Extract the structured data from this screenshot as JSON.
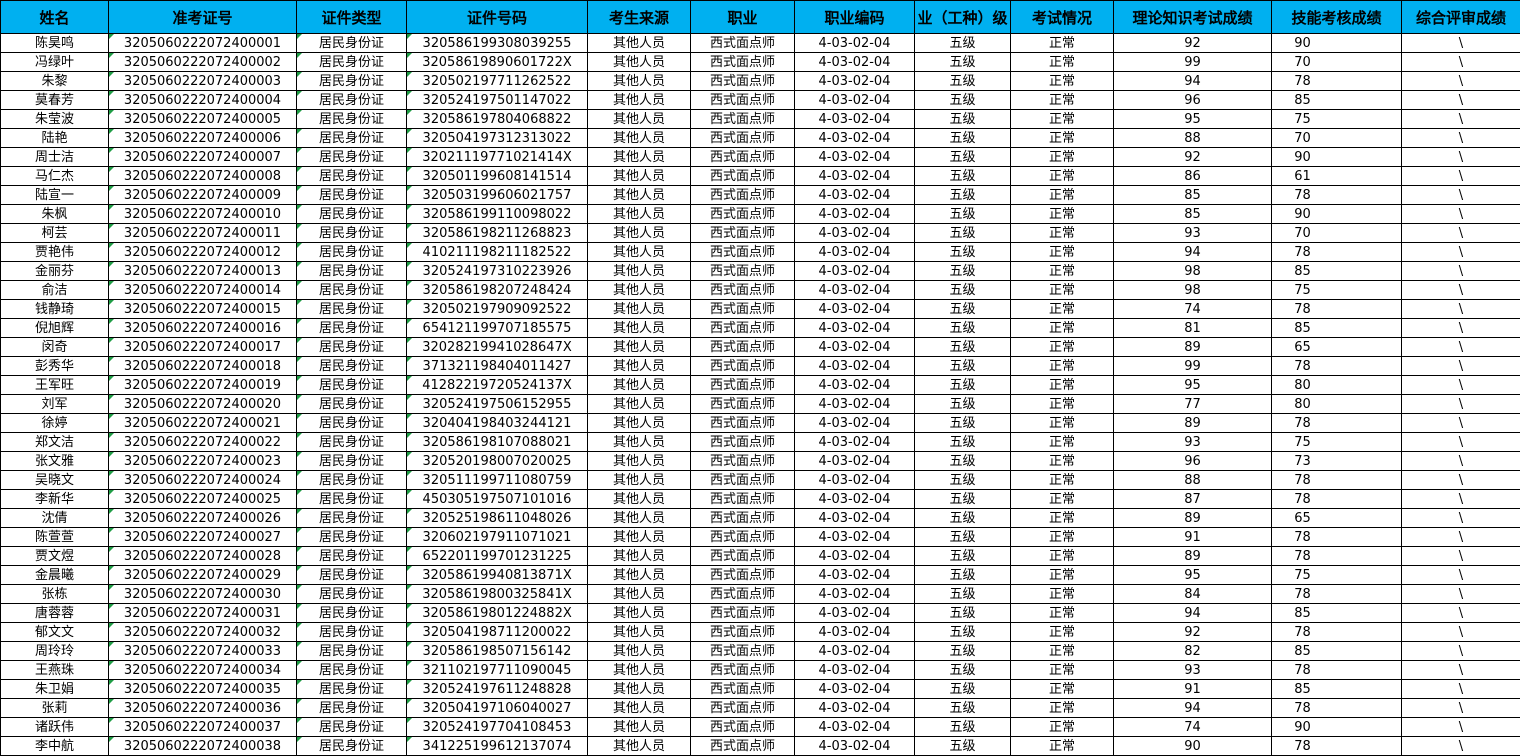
{
  "headers": [
    "姓名",
    "准考证号",
    "证件类型",
    "证件号码",
    "考生来源",
    "职业",
    "职业编码",
    "业（工种）级",
    "考试情况",
    "理论知识考试成绩",
    "技能考核成绩",
    "综合评审成绩"
  ],
  "rows": [
    [
      "陈昊鸣",
      "3205060222072400001",
      "居民身份证",
      "320586199308039255",
      "其他人员",
      "西式面点师",
      "4-03-02-04",
      "五级",
      "正常",
      "92",
      "90",
      "\\"
    ],
    [
      "冯绿叶",
      "3205060222072400002",
      "居民身份证",
      "32058619890601722X",
      "其他人员",
      "西式面点师",
      "4-03-02-04",
      "五级",
      "正常",
      "99",
      "70",
      "\\"
    ],
    [
      "朱黎",
      "3205060222072400003",
      "居民身份证",
      "320502197711262522",
      "其他人员",
      "西式面点师",
      "4-03-02-04",
      "五级",
      "正常",
      "94",
      "78",
      "\\"
    ],
    [
      "莫春芳",
      "3205060222072400004",
      "居民身份证",
      "320524197501147022",
      "其他人员",
      "西式面点师",
      "4-03-02-04",
      "五级",
      "正常",
      "96",
      "85",
      "\\"
    ],
    [
      "朱莹波",
      "3205060222072400005",
      "居民身份证",
      "320586197804068822",
      "其他人员",
      "西式面点师",
      "4-03-02-04",
      "五级",
      "正常",
      "95",
      "75",
      "\\"
    ],
    [
      "陆艳",
      "3205060222072400006",
      "居民身份证",
      "320504197312313022",
      "其他人员",
      "西式面点师",
      "4-03-02-04",
      "五级",
      "正常",
      "88",
      "70",
      "\\"
    ],
    [
      "周士洁",
      "3205060222072400007",
      "居民身份证",
      "32021119771021414X",
      "其他人员",
      "西式面点师",
      "4-03-02-04",
      "五级",
      "正常",
      "92",
      "90",
      "\\"
    ],
    [
      "马仁杰",
      "3205060222072400008",
      "居民身份证",
      "320501199608141514",
      "其他人员",
      "西式面点师",
      "4-03-02-04",
      "五级",
      "正常",
      "86",
      "61",
      "\\"
    ],
    [
      "陆宣一",
      "3205060222072400009",
      "居民身份证",
      "320503199606021757",
      "其他人员",
      "西式面点师",
      "4-03-02-04",
      "五级",
      "正常",
      "85",
      "78",
      "\\"
    ],
    [
      "朱枫",
      "3205060222072400010",
      "居民身份证",
      "320586199110098022",
      "其他人员",
      "西式面点师",
      "4-03-02-04",
      "五级",
      "正常",
      "85",
      "90",
      "\\"
    ],
    [
      "柯芸",
      "3205060222072400011",
      "居民身份证",
      "320586198211268823",
      "其他人员",
      "西式面点师",
      "4-03-02-04",
      "五级",
      "正常",
      "93",
      "70",
      "\\"
    ],
    [
      "贾艳伟",
      "3205060222072400012",
      "居民身份证",
      "410211198211182522",
      "其他人员",
      "西式面点师",
      "4-03-02-04",
      "五级",
      "正常",
      "94",
      "78",
      "\\"
    ],
    [
      "金丽芬",
      "3205060222072400013",
      "居民身份证",
      "320524197310223926",
      "其他人员",
      "西式面点师",
      "4-03-02-04",
      "五级",
      "正常",
      "98",
      "85",
      "\\"
    ],
    [
      "俞洁",
      "3205060222072400014",
      "居民身份证",
      "320586198207248424",
      "其他人员",
      "西式面点师",
      "4-03-02-04",
      "五级",
      "正常",
      "98",
      "75",
      "\\"
    ],
    [
      "钱静琦",
      "3205060222072400015",
      "居民身份证",
      "320502197909092522",
      "其他人员",
      "西式面点师",
      "4-03-02-04",
      "五级",
      "正常",
      "74",
      "78",
      "\\"
    ],
    [
      "倪旭辉",
      "3205060222072400016",
      "居民身份证",
      "654121199707185575",
      "其他人员",
      "西式面点师",
      "4-03-02-04",
      "五级",
      "正常",
      "81",
      "85",
      "\\"
    ],
    [
      "闵奇",
      "3205060222072400017",
      "居民身份证",
      "32028219941028647X",
      "其他人员",
      "西式面点师",
      "4-03-02-04",
      "五级",
      "正常",
      "89",
      "65",
      "\\"
    ],
    [
      "彭秀华",
      "3205060222072400018",
      "居民身份证",
      "371321198404011427",
      "其他人员",
      "西式面点师",
      "4-03-02-04",
      "五级",
      "正常",
      "99",
      "78",
      "\\"
    ],
    [
      "王军旺",
      "3205060222072400019",
      "居民身份证",
      "41282219720524137X",
      "其他人员",
      "西式面点师",
      "4-03-02-04",
      "五级",
      "正常",
      "95",
      "80",
      "\\"
    ],
    [
      "刘军",
      "3205060222072400020",
      "居民身份证",
      "320524197506152955",
      "其他人员",
      "西式面点师",
      "4-03-02-04",
      "五级",
      "正常",
      "77",
      "80",
      "\\"
    ],
    [
      "徐婷",
      "3205060222072400021",
      "居民身份证",
      "320404198403244121",
      "其他人员",
      "西式面点师",
      "4-03-02-04",
      "五级",
      "正常",
      "89",
      "78",
      "\\"
    ],
    [
      "郑文洁",
      "3205060222072400022",
      "居民身份证",
      "320586198107088021",
      "其他人员",
      "西式面点师",
      "4-03-02-04",
      "五级",
      "正常",
      "93",
      "75",
      "\\"
    ],
    [
      "张文雅",
      "3205060222072400023",
      "居民身份证",
      "320520198007020025",
      "其他人员",
      "西式面点师",
      "4-03-02-04",
      "五级",
      "正常",
      "96",
      "73",
      "\\"
    ],
    [
      "吴晓文",
      "3205060222072400024",
      "居民身份证",
      "320511199711080759",
      "其他人员",
      "西式面点师",
      "4-03-02-04",
      "五级",
      "正常",
      "88",
      "78",
      "\\"
    ],
    [
      "李新华",
      "3205060222072400025",
      "居民身份证",
      "450305197507101016",
      "其他人员",
      "西式面点师",
      "4-03-02-04",
      "五级",
      "正常",
      "87",
      "78",
      "\\"
    ],
    [
      "沈倩",
      "3205060222072400026",
      "居民身份证",
      "320525198611048026",
      "其他人员",
      "西式面点师",
      "4-03-02-04",
      "五级",
      "正常",
      "89",
      "65",
      "\\"
    ],
    [
      "陈萱萱",
      "3205060222072400027",
      "居民身份证",
      "320602197911071021",
      "其他人员",
      "西式面点师",
      "4-03-02-04",
      "五级",
      "正常",
      "91",
      "78",
      "\\"
    ],
    [
      "贾文煜",
      "3205060222072400028",
      "居民身份证",
      "652201199701231225",
      "其他人员",
      "西式面点师",
      "4-03-02-04",
      "五级",
      "正常",
      "89",
      "78",
      "\\"
    ],
    [
      "金晨曦",
      "3205060222072400029",
      "居民身份证",
      "32058619940813871X",
      "其他人员",
      "西式面点师",
      "4-03-02-04",
      "五级",
      "正常",
      "95",
      "75",
      "\\"
    ],
    [
      "张栋",
      "3205060222072400030",
      "居民身份证",
      "32058619800325841X",
      "其他人员",
      "西式面点师",
      "4-03-02-04",
      "五级",
      "正常",
      "84",
      "78",
      "\\"
    ],
    [
      "唐蓉蓉",
      "3205060222072400031",
      "居民身份证",
      "32058619801224882X",
      "其他人员",
      "西式面点师",
      "4-03-02-04",
      "五级",
      "正常",
      "94",
      "85",
      "\\"
    ],
    [
      "郁文文",
      "3205060222072400032",
      "居民身份证",
      "320504198711200022",
      "其他人员",
      "西式面点师",
      "4-03-02-04",
      "五级",
      "正常",
      "92",
      "78",
      "\\"
    ],
    [
      "周玲玲",
      "3205060222072400033",
      "居民身份证",
      "320586198507156142",
      "其他人员",
      "西式面点师",
      "4-03-02-04",
      "五级",
      "正常",
      "82",
      "85",
      "\\"
    ],
    [
      "王燕珠",
      "3205060222072400034",
      "居民身份证",
      "321102197711090045",
      "其他人员",
      "西式面点师",
      "4-03-02-04",
      "五级",
      "正常",
      "93",
      "78",
      "\\"
    ],
    [
      "朱卫娟",
      "3205060222072400035",
      "居民身份证",
      "320524197611248828",
      "其他人员",
      "西式面点师",
      "4-03-02-04",
      "五级",
      "正常",
      "91",
      "85",
      "\\"
    ],
    [
      "张莉",
      "3205060222072400036",
      "居民身份证",
      "320504197106040027",
      "其他人员",
      "西式面点师",
      "4-03-02-04",
      "五级",
      "正常",
      "94",
      "78",
      "\\"
    ],
    [
      "诸跃伟",
      "3205060222072400037",
      "居民身份证",
      "320524197704108453",
      "其他人员",
      "西式面点师",
      "4-03-02-04",
      "五级",
      "正常",
      "74",
      "90",
      "\\"
    ],
    [
      "李中航",
      "3205060222072400038",
      "居民身份证",
      "341225199612137074",
      "其他人员",
      "西式面点师",
      "4-03-02-04",
      "五级",
      "正常",
      "90",
      "78",
      "\\"
    ]
  ],
  "colors": {
    "header_bg": "#00b0f0",
    "text_flag": "#1f9d45",
    "grid": "#000000"
  }
}
